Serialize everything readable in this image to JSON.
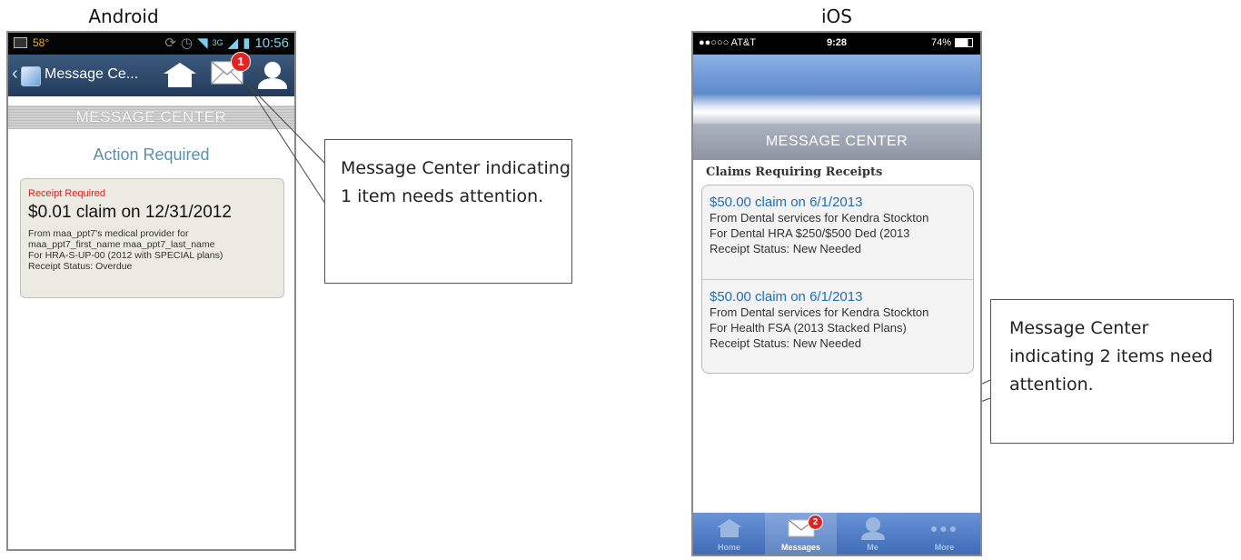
{
  "captions": {
    "android": "Android",
    "ios": "iOS"
  },
  "android": {
    "status": {
      "temp": "58°",
      "network": "3G",
      "time": "10:56"
    },
    "appbar": {
      "title": "Message Ce...",
      "badge": "1"
    },
    "banner": "MESSAGE CENTER",
    "action_required": "Action Required",
    "card": {
      "status_label": "Receipt Required",
      "amount": "$0.01 claim on 12/31/2012",
      "lines": [
        "From maa_ppt7's medical provider for",
        "maa_ppt7_first_name maa_ppt7_last_name",
        "For HRA-S-UP-00 (2012 with SPECIAL plans)",
        "Receipt Status: Overdue"
      ]
    }
  },
  "callouts": {
    "android": "Message Center indicating 1 item needs attention.",
    "ios": "Message Center indicating 2 items need attention."
  },
  "ios": {
    "status": {
      "carrier": "●●○○○ AT&T",
      "time": "9:28",
      "battery": "74%"
    },
    "banner": "MESSAGE CENTER",
    "section": "Claims Requiring Receipts",
    "claims": [
      {
        "amount": "$50.00 claim on 6/1/2013",
        "from": "From Dental services for Kendra Stockton",
        "plan": "For Dental HRA $250/$500 Ded (2013",
        "status": "Receipt Status: New Needed"
      },
      {
        "amount": "$50.00 claim on 6/1/2013",
        "from": "From Dental services for Kendra Stockton",
        "plan": "For Health FSA (2013 Stacked Plans)",
        "status": "Receipt Status: New Needed"
      }
    ],
    "tabbar": {
      "badge": "2",
      "tabs": [
        "Home",
        "Messages",
        "Me",
        "More"
      ]
    }
  }
}
